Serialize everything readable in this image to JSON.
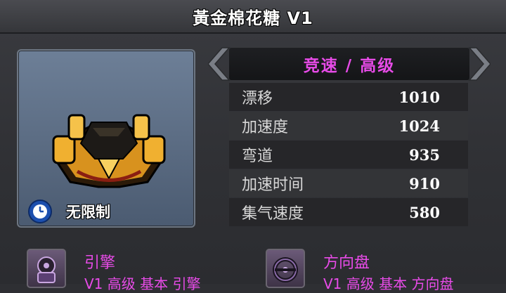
{
  "title": "黃金棉花糖 V1",
  "item": {
    "limit_label": "无限制",
    "image": "golden-kart-image",
    "clock_icon": "clock-icon"
  },
  "category": {
    "label": "竞速 / 高级",
    "prev_icon": "chevron-left-icon",
    "next_icon": "chevron-right-icon"
  },
  "stats": [
    {
      "label": "漂移",
      "value": "1010"
    },
    {
      "label": "加速度",
      "value": "1024"
    },
    {
      "label": "弯道",
      "value": "935"
    },
    {
      "label": "加速时间",
      "value": "910"
    },
    {
      "label": "集气速度",
      "value": "580"
    }
  ],
  "parts": [
    {
      "name": "引擎",
      "desc": "V1 高级 基本 引擎",
      "icon": "engine-icon"
    },
    {
      "name": "方向盘",
      "desc": "V1 高级 基本 方向盘",
      "icon": "steering-wheel-icon"
    }
  ],
  "colors": {
    "accent_magenta": "#e84be8",
    "panel_bg": "#303135",
    "item_box": "#5d6e85"
  }
}
